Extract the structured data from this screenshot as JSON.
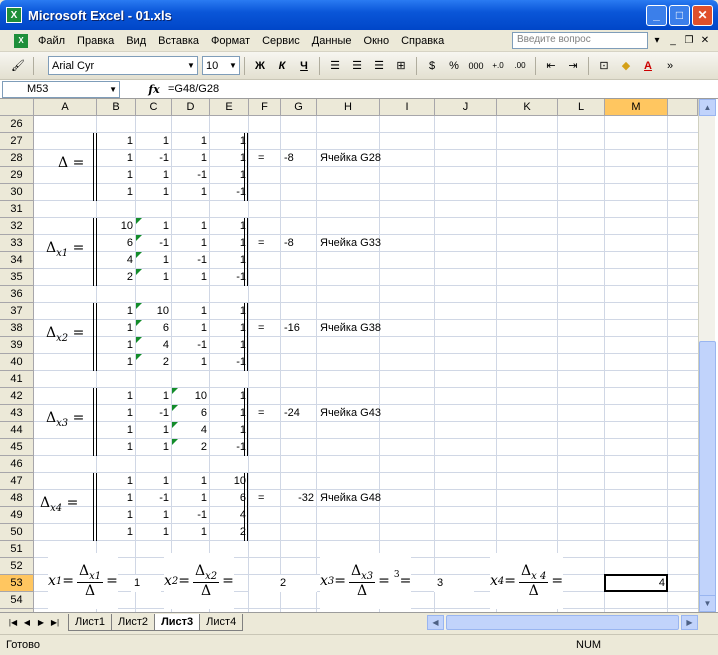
{
  "window": {
    "title": "Microsoft Excel - 01.xls",
    "app_icon": "X"
  },
  "menu": {
    "items": [
      "Файл",
      "Правка",
      "Вид",
      "Вставка",
      "Формат",
      "Сервис",
      "Данные",
      "Окно",
      "Справка"
    ],
    "help_placeholder": "Введите вопрос"
  },
  "toolbar": {
    "font": "Arial Cyr",
    "size": "10",
    "bold": "Ж",
    "italic": "К",
    "underline": "Ч",
    "percent": "%",
    "thousands": "000"
  },
  "formula_bar": {
    "cell_ref": "M53",
    "fx": "fx",
    "formula": "=G48/G28"
  },
  "columns": [
    "A",
    "B",
    "C",
    "D",
    "E",
    "F",
    "G",
    "H",
    "I",
    "J",
    "K",
    "L",
    "M"
  ],
  "selected_column": "M",
  "rows": [
    "26",
    "27",
    "28",
    "29",
    "30",
    "31",
    "32",
    "33",
    "34",
    "35",
    "36",
    "37",
    "38",
    "39",
    "40",
    "41",
    "42",
    "43",
    "44",
    "45",
    "46",
    "47",
    "48",
    "49",
    "50",
    "51",
    "52",
    "53",
    "54",
    "55"
  ],
  "selected_row": "53",
  "blocks": [
    {
      "label": "Δ",
      "sub": "",
      "eq": "=",
      "result": "-8",
      "ref_text": "Ячейка G28",
      "matrix": [
        [
          "1",
          "1",
          "1",
          "1"
        ],
        [
          "1",
          "-1",
          "1",
          "1"
        ],
        [
          "1",
          "1",
          "-1",
          "1"
        ],
        [
          "1",
          "1",
          "1",
          "-1"
        ]
      ]
    },
    {
      "label": "Δ",
      "sub": "x1",
      "eq": "=",
      "result": "-8",
      "ref_text": "Ячейка G33",
      "matrix": [
        [
          "10",
          "1",
          "1",
          "1"
        ],
        [
          "6",
          "-1",
          "1",
          "1"
        ],
        [
          "4",
          "1",
          "-1",
          "1"
        ],
        [
          "2",
          "1",
          "1",
          "-1"
        ]
      ]
    },
    {
      "label": "Δ",
      "sub": "x2",
      "eq": "=",
      "result": "-16",
      "ref_text": "Ячейка G38",
      "matrix": [
        [
          "1",
          "10",
          "1",
          "1"
        ],
        [
          "1",
          "6",
          "1",
          "1"
        ],
        [
          "1",
          "4",
          "-1",
          "1"
        ],
        [
          "1",
          "2",
          "1",
          "-1"
        ]
      ]
    },
    {
      "label": "Δ",
      "sub": "x3",
      "eq": "=",
      "result": "-24",
      "ref_text": "Ячейка G43",
      "matrix": [
        [
          "1",
          "1",
          "10",
          "1"
        ],
        [
          "1",
          "-1",
          "6",
          "1"
        ],
        [
          "1",
          "1",
          "4",
          "1"
        ],
        [
          "1",
          "1",
          "2",
          "-1"
        ]
      ]
    },
    {
      "label": "Δ",
      "sub": "x4",
      "eq": "=",
      "result": "-32",
      "ref_text": "Ячейка G48",
      "matrix": [
        [
          "1",
          "1",
          "1",
          "10"
        ],
        [
          "1",
          "-1",
          "1",
          "6"
        ],
        [
          "1",
          "1",
          "-1",
          "4"
        ],
        [
          "1",
          "1",
          "1",
          "2"
        ]
      ]
    }
  ],
  "results": {
    "x1": {
      "var": "x",
      "sub": "1",
      "num": "Δ",
      "num_sub": "x1",
      "den": "Δ",
      "value": "1"
    },
    "x2": {
      "var": "x",
      "sub": "2",
      "num": "Δ",
      "num_sub": "x2",
      "den": "Δ",
      "value": "2"
    },
    "x3": {
      "var": "x",
      "sub": "3",
      "num": "Δ",
      "num_sub": "x3",
      "den": "Δ",
      "value": "3",
      "extra": "3"
    },
    "x4": {
      "var": "x",
      "sub": "4",
      "num": "Δ",
      "num_sub": "x 4",
      "den": "Δ",
      "value": "4"
    }
  },
  "sheets": [
    "Лист1",
    "Лист2",
    "Лист3",
    "Лист4"
  ],
  "active_sheet": "Лист3",
  "status": {
    "left": "Готово",
    "num": "NUM"
  },
  "colors": {
    "title_bar": "#0a56d8",
    "selected_header": "#ffc660",
    "error_triangle": "#138c2a",
    "grid_line": "#d0d7e5"
  }
}
